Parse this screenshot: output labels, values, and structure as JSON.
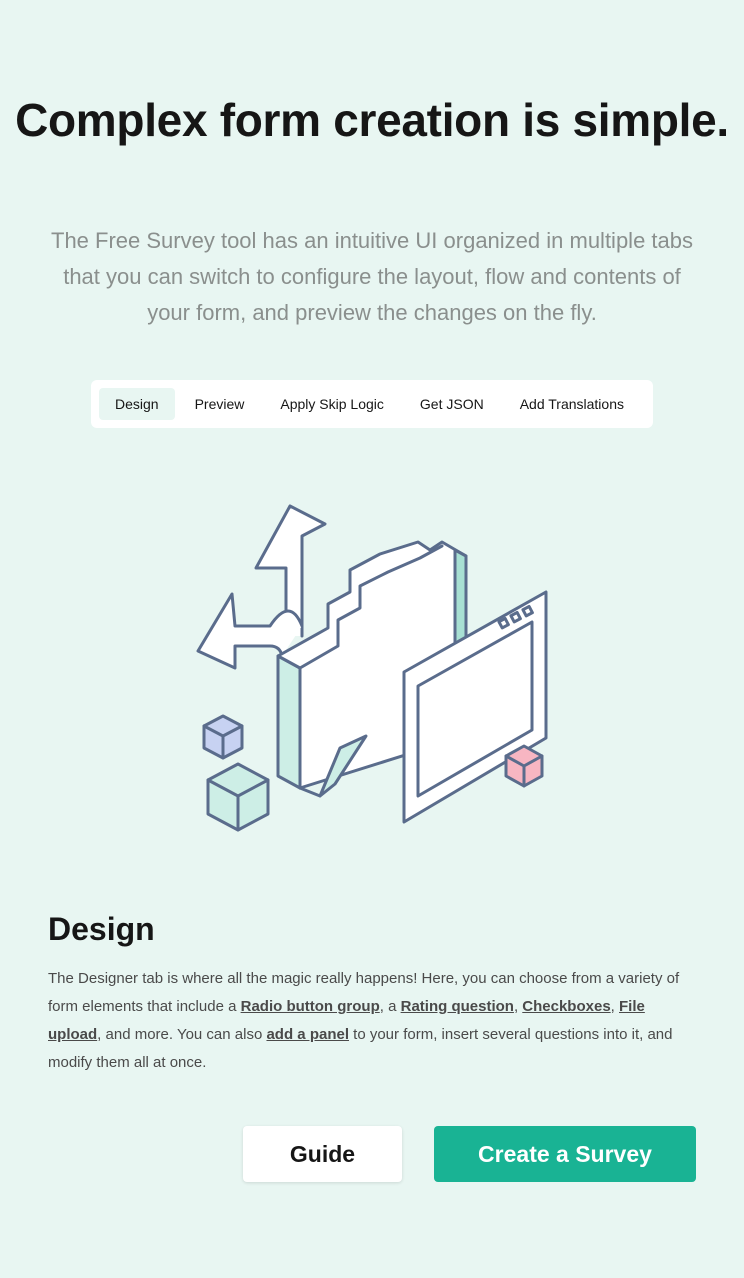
{
  "hero": {
    "title": "Complex form creation is simple.",
    "subtitle": "The Free Survey tool has an intuitive UI organized in multiple tabs that you can switch to configure the layout, flow and contents of your form, and preview the changes on the fly."
  },
  "tabs": [
    {
      "label": "Design",
      "active": true
    },
    {
      "label": "Preview",
      "active": false
    },
    {
      "label": "Apply Skip Logic",
      "active": false
    },
    {
      "label": "Get JSON",
      "active": false
    },
    {
      "label": "Add Translations",
      "active": false
    }
  ],
  "illustration": {
    "icon": "designer-illustration",
    "colors": {
      "outline": "#5a6c8c",
      "mint": "#cdeee6",
      "mint_dark": "#a8e0d3",
      "pink": "#f7b6c2",
      "lavender": "#c7d2f2"
    }
  },
  "section": {
    "title": "Design",
    "body_parts": {
      "p1": "The Designer tab is where all the magic really happens! Here, you can choose from a variety of form elements that include a ",
      "link1": "Radio button group",
      "p2": ", a ",
      "link2": "Rating question",
      "p3": ", ",
      "link3": "Checkboxes",
      "p4": ", ",
      "link4": "File upload",
      "p5": ", and more. You can also ",
      "link5": "add a panel",
      "p6": " to your form, insert several questions into it, and modify them all at once."
    }
  },
  "buttons": {
    "guide": "Guide",
    "create": "Create a Survey"
  },
  "colors": {
    "background": "#e8f6f2",
    "accent": "#19b394"
  }
}
